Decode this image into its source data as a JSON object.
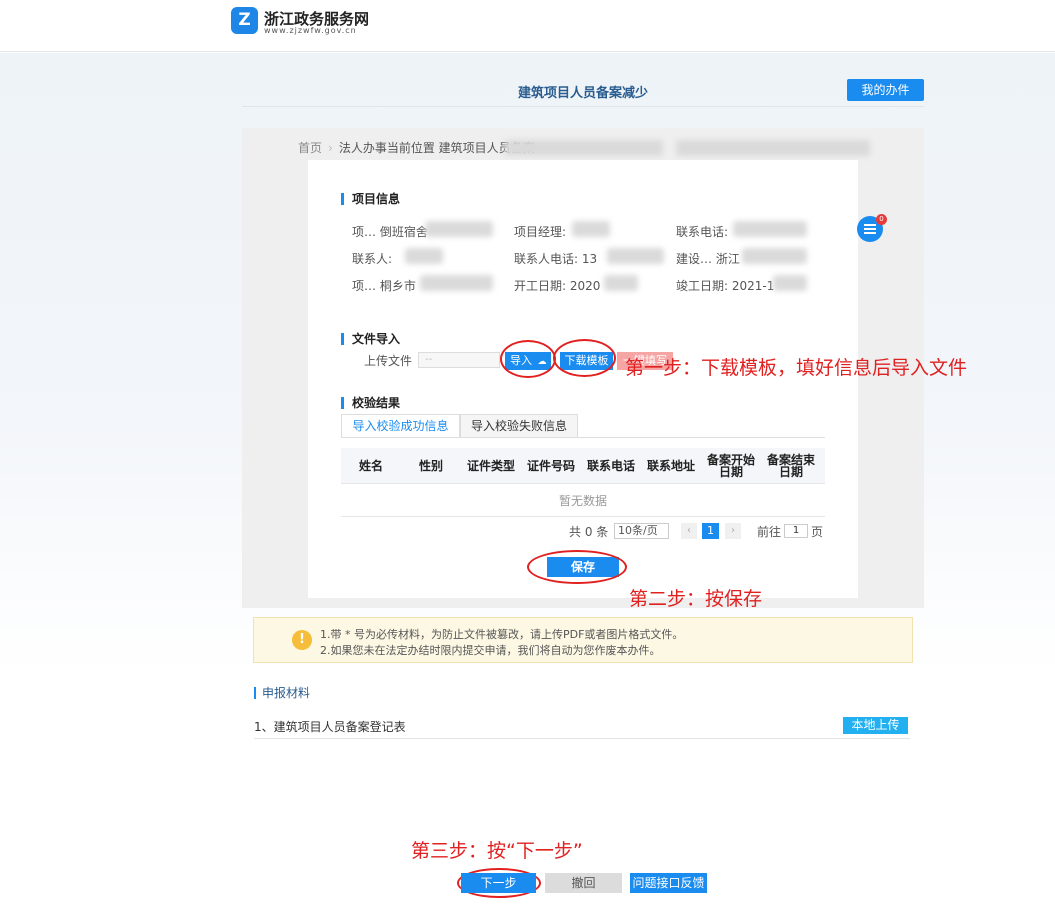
{
  "header": {
    "logo_mark": "Z",
    "site_name": "浙江政务服务网",
    "site_url": "www.zjzwfw.gov.cn"
  },
  "page": {
    "title": "建筑项目人员备案减少",
    "my_office_button": "我的办件"
  },
  "breadcrumb": {
    "home": "首页",
    "current": "法人办事当前位置 建筑项目人员备案"
  },
  "project_info": {
    "title": "项目信息",
    "fields": {
      "project_name": "项…  倒班宿舍",
      "project_manager": "项目经理:",
      "contact_phone": "联系电话:",
      "contact_person": "联系人:",
      "contact_person_phone": "联系人电话:  13",
      "builder": "建设…  浙江",
      "project_location": "项…  桐乡市",
      "start_date": "开工日期:  2020",
      "end_date": "竣工日期:  2021-1"
    }
  },
  "float_badge_count": "0",
  "file_import": {
    "title": "文件导入",
    "upload_label": "上传文件",
    "upload_placeholder": "--",
    "import_button": "导入",
    "download_template_button": "下载模板",
    "third_button": "一键填写"
  },
  "validation": {
    "title": "校验结果",
    "tabs": [
      "导入校验成功信息",
      "导入校验失败信息"
    ],
    "columns": [
      "姓名",
      "性别",
      "证件类型",
      "证件号码",
      "联系电话",
      "联系地址",
      "备案开始日期",
      "备案结束日期"
    ],
    "empty_text": "暂无数据",
    "pagination": {
      "total": "共 0 条",
      "page_size": "10条/页",
      "current_page": "1",
      "goto_label": "前往",
      "goto_value": "1",
      "page_suffix": "页"
    },
    "save_button": "保存"
  },
  "annotations": {
    "step1": "第一步：下载模板，填好信息后导入文件",
    "step2": "第二步：按保存",
    "step3": "第三步：按“下一步”",
    "color": "#e12020"
  },
  "notice": {
    "line1": "1.带 * 号为必传材料，为防止文件被篡改，请上传PDF或者图片格式文件。",
    "line2": "2.如果您未在法定办结时限内提交申请，我们将自动为您作废本办件。"
  },
  "materials": {
    "title": "申报材料",
    "items": [
      {
        "label": "1、建筑项目人员备案登记表",
        "action": "本地上传"
      }
    ]
  },
  "footer_buttons": {
    "next": "下一步",
    "revoke": "撤回",
    "feedback": "问题接口反馈"
  },
  "colors": {
    "primary": "#1a8cf0",
    "brand": "#1e86e6",
    "annotation_red": "#e12020"
  }
}
